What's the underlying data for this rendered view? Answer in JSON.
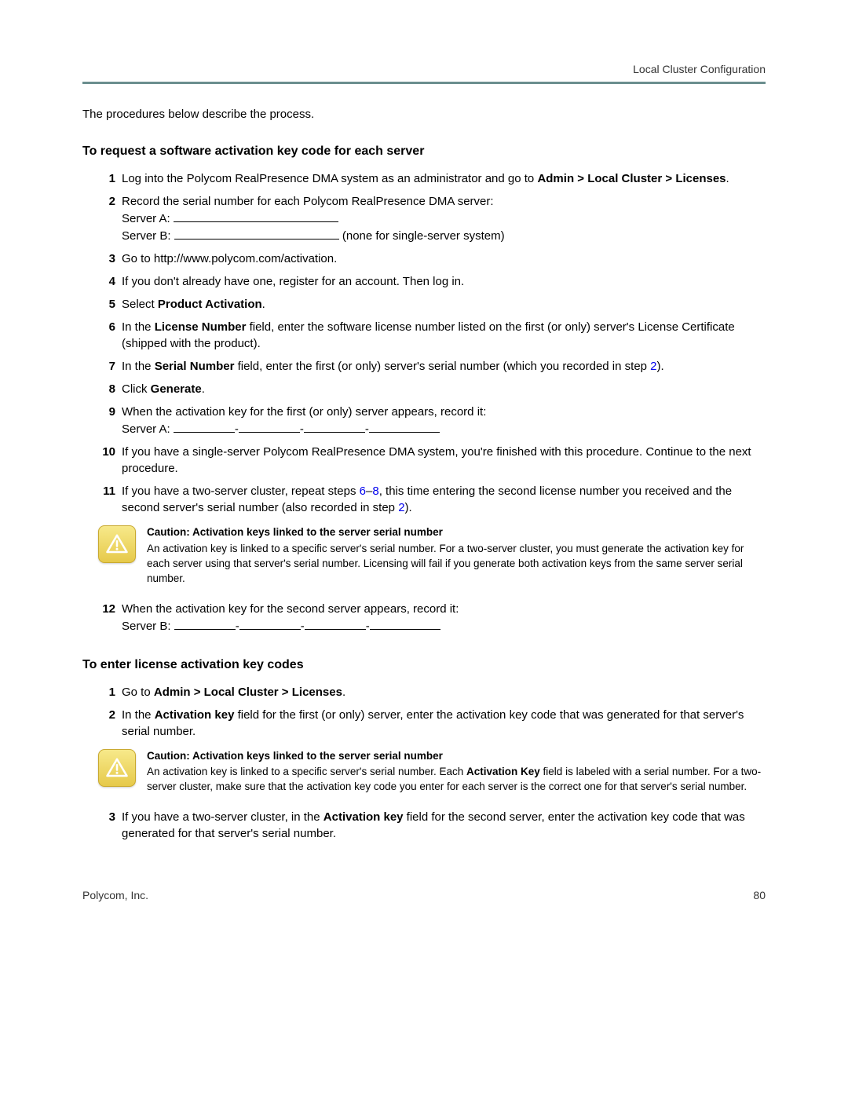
{
  "header": {
    "section": "Local Cluster Configuration"
  },
  "intro": "The procedures below describe the process.",
  "section1": {
    "heading": "To request a software activation key code for each server",
    "steps": {
      "s1_a": "Log into the Polycom RealPresence DMA system as an administrator and go to ",
      "s1_b": "Admin > Local Cluster > Licenses",
      "s1_c": ".",
      "s2_a": "Record the serial number for each Polycom RealPresence DMA server:",
      "s2_serverA": "Server A:  ",
      "s2_serverB": "Server B:  ",
      "s2_note": " (none for single-server system)",
      "s3": "Go to http://www.polycom.com/activation.",
      "s4": "If you don't already have one, register for an account. Then log in.",
      "s5_a": "Select ",
      "s5_b": "Product Activation",
      "s5_c": ".",
      "s6_a": "In the ",
      "s6_b": "License Number",
      "s6_c": " field, enter the software license number listed on the first (or only) server's License Certificate (shipped with the product).",
      "s7_a": "In the ",
      "s7_b": "Serial Number",
      "s7_c": " field, enter the first (or only) server's serial number (which you recorded in step ",
      "s7_ref": "2",
      "s7_d": ").",
      "s8_a": "Click ",
      "s8_b": "Generate",
      "s8_c": ".",
      "s9_a": "When the activation key for the first (or only) server appears, record it:",
      "s9_serverA": "Server A:  ",
      "s10": "If you have a single-server Polycom RealPresence DMA system, you're finished with this procedure. Continue to the next procedure.",
      "s11_a": "If you have a two-server cluster, repeat steps ",
      "s11_ref1": "6",
      "s11_dash": "–",
      "s11_ref2": "8",
      "s11_b": ", this time entering the second license number you received and the second server's serial number (also recorded in step ",
      "s11_ref3": "2",
      "s11_c": ").",
      "s12_a": "When the activation key for the second server appears, record it:",
      "s12_serverB": "Server B:  "
    },
    "caution": {
      "title": "Caution: Activation keys linked to the server serial number",
      "body": "An activation key is linked to a specific server's serial number. For a two-server cluster, you must generate the activation key for each server using that server's serial number. Licensing will fail if you generate both activation keys from the same server serial number."
    }
  },
  "section2": {
    "heading": "To enter license activation key codes",
    "steps": {
      "s1_a": "Go to ",
      "s1_b": "Admin > Local Cluster > Licenses",
      "s1_c": ".",
      "s2_a": "In the ",
      "s2_b": "Activation key",
      "s2_c": " field for the first (or only) server, enter the activation key code that was generated for that server's serial number.",
      "s3_a": "If you have a two-server cluster, in the ",
      "s3_b": "Activation key",
      "s3_c": " field for the second server, enter the activation key code that was generated for that server's serial number."
    },
    "caution": {
      "title": "Caution: Activation keys linked to the server serial number",
      "body_a": "An activation key is linked to a specific server's serial number. Each ",
      "body_b": "Activation Key",
      "body_c": " field is labeled with a serial number. For a two-server cluster, make sure that the activation key code you enter for each server is the correct one for that server's serial number."
    }
  },
  "footer": {
    "left": "Polycom, Inc.",
    "right": "80"
  }
}
